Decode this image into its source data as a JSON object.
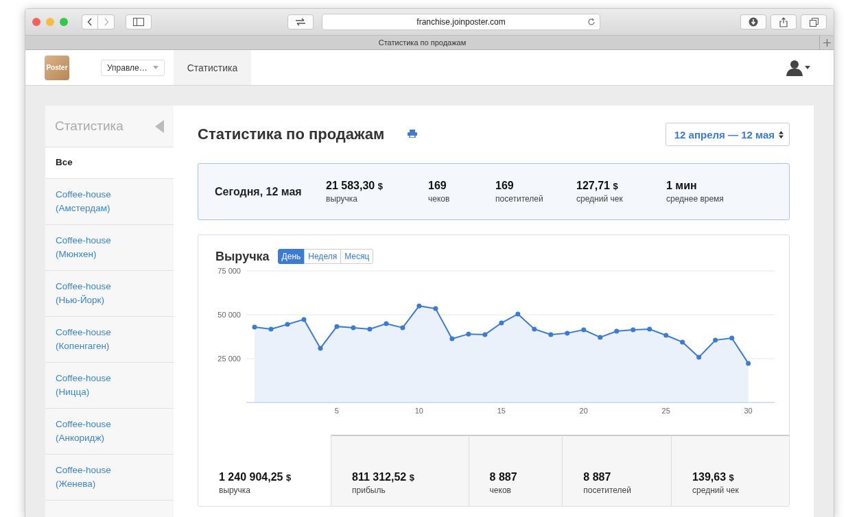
{
  "browser": {
    "url": "franchise.joinposter.com",
    "tab_title": "Статистика по продажам"
  },
  "header": {
    "logo": "Poster",
    "dropdown": "Управле…",
    "nav": [
      {
        "label": "Статистика",
        "selected": true
      }
    ]
  },
  "sidebar": {
    "title": "Статистика",
    "items": [
      {
        "label": "Все",
        "selected": true
      },
      {
        "label": "Coffee-house (Амстердам)",
        "selected": false
      },
      {
        "label": "Coffee-house (Мюнхен)",
        "selected": false
      },
      {
        "label": "Coffee-house (Нью-Йорк)",
        "selected": false
      },
      {
        "label": "Coffee-house (Копенгаген)",
        "selected": false
      },
      {
        "label": "Coffee-house (Ницца)",
        "selected": false
      },
      {
        "label": "Coffee-house (Анкоридж)",
        "selected": false
      },
      {
        "label": "Coffee-house (Женева)",
        "selected": false
      }
    ]
  },
  "page": {
    "title": "Статистика по продажам",
    "date_range": "12 апреля — 12 мая"
  },
  "today": {
    "date": "Сегодня, 12 мая",
    "stats": [
      {
        "value": "21 583,30",
        "unit": "$",
        "label": "выручка"
      },
      {
        "value": "169",
        "label": "чеков"
      },
      {
        "value": "169",
        "label": "посетителей"
      },
      {
        "value": "127,71",
        "unit": "$",
        "label": "средний чек"
      },
      {
        "value": "1 мин",
        "label": "среднее время"
      }
    ]
  },
  "revenue": {
    "periods": [
      {
        "label": "День",
        "selected": true
      },
      {
        "label": "Неделя",
        "selected": false
      },
      {
        "label": "Месяц",
        "selected": false
      }
    ],
    "chart_data": {
      "type": "area",
      "title": "Выручка",
      "x": [
        0,
        1,
        2,
        3,
        4,
        5,
        6,
        7,
        8,
        9,
        10,
        11,
        12,
        13,
        14,
        15,
        16,
        17,
        18,
        19,
        20,
        21,
        22,
        23,
        24,
        25,
        26,
        27,
        28,
        29,
        30
      ],
      "series": [
        {
          "color": "#3a7bd5",
          "values": [
            43000,
            41800,
            44500,
            47300,
            30900,
            43300,
            42600,
            41800,
            44900,
            42600,
            55000,
            53500,
            36300,
            39000,
            38700,
            45300,
            50400,
            41800,
            38700,
            39500,
            41400,
            37100,
            40600,
            41400,
            41800,
            38300,
            34400,
            25800,
            35500,
            36700,
            22300
          ]
        }
      ],
      "ylim": [
        0,
        75000
      ],
      "yticks": [
        {
          "value": 25000,
          "label": "25 000"
        },
        {
          "value": 50000,
          "label": "50 000"
        },
        {
          "value": 75000,
          "label": "75 000"
        }
      ],
      "xlim": [
        -0.5,
        31.6
      ],
      "xticks": [
        5,
        10,
        15,
        20,
        25,
        30
      ]
    }
  },
  "totals": [
    {
      "value": "1 240 904,25",
      "unit": "$",
      "label": "выручка",
      "selected": true
    },
    {
      "value": "811 312,52",
      "unit": "$",
      "label": "прибыль",
      "selected": false
    },
    {
      "value": "8 887",
      "label": "чеков",
      "selected": false
    },
    {
      "value": "8 887",
      "label": "посетителей",
      "selected": false
    },
    {
      "value": "139,63",
      "unit": "$",
      "label": "средний чек",
      "selected": false
    }
  ]
}
